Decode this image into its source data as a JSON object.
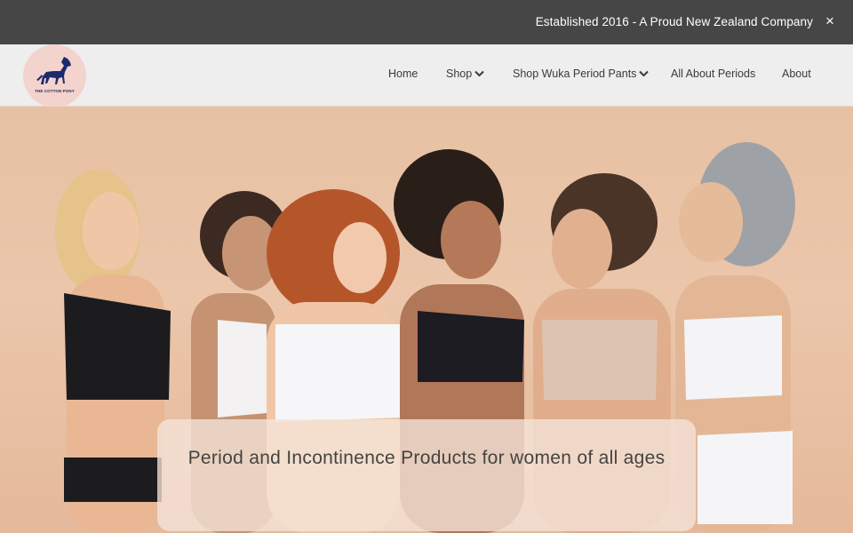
{
  "announcement": {
    "text": "Established 2016 - A Proud New Zealand Company",
    "close_icon": "×"
  },
  "brand": {
    "logo_text": "THE COTTON PONY",
    "logo_bg": "#f3d3ce",
    "logo_color": "#1c2a6e"
  },
  "nav": {
    "items": [
      {
        "label": "Home",
        "has_dropdown": false
      },
      {
        "label": "Shop",
        "has_dropdown": true
      },
      {
        "label": "Shop Wuka Period Pants",
        "has_dropdown": true
      },
      {
        "label": "All About Periods",
        "has_dropdown": false
      },
      {
        "label": "About",
        "has_dropdown": false
      }
    ]
  },
  "hero": {
    "image_name": "hero-photo",
    "caption": "Period and Incontinence Products for women of all ages"
  },
  "colors": {
    "announce_bg": "#464646",
    "nav_bg": "#eeeeee",
    "hero_bg": "#e8c1a4"
  }
}
